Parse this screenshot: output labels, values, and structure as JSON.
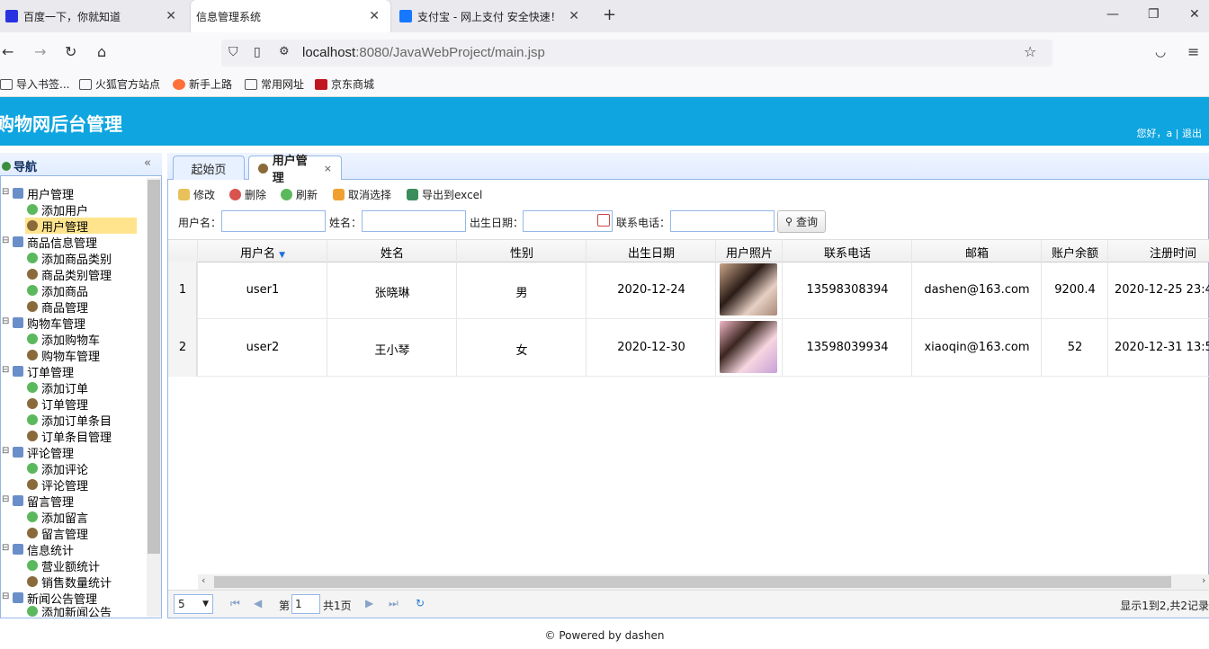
{
  "browser": {
    "tabs": [
      {
        "title": "百度一下，你就知道"
      },
      {
        "title": "信息管理系统"
      },
      {
        "title": "支付宝 - 网上支付 安全快速！"
      }
    ],
    "url_host": "localhost",
    "url_rest": ":8080/JavaWebProject/main.jsp",
    "bookmarks": [
      "导入书签...",
      "火狐官方站点",
      "新手上路",
      "常用网址",
      "京东商城"
    ]
  },
  "app": {
    "title": "购物网后台管理",
    "greeting": "您好，a | 退出",
    "footer": "© Powered by dashen"
  },
  "sidebar": {
    "title": "导航",
    "collapse": "«",
    "groups": [
      {
        "label": "用户管理",
        "items": [
          "添加用户",
          "用户管理"
        ]
      },
      {
        "label": "商品信息管理",
        "items": [
          "添加商品类别",
          "商品类别管理",
          "添加商品",
          "商品管理"
        ]
      },
      {
        "label": "购物车管理",
        "items": [
          "添加购物车",
          "购物车管理"
        ]
      },
      {
        "label": "订单管理",
        "items": [
          "添加订单",
          "订单管理",
          "添加订单条目",
          "订单条目管理"
        ]
      },
      {
        "label": "评论管理",
        "items": [
          "添加评论",
          "评论管理"
        ]
      },
      {
        "label": "留言管理",
        "items": [
          "添加留言",
          "留言管理"
        ]
      },
      {
        "label": "信息统计",
        "items": [
          "营业额统计",
          "销售数量统计"
        ]
      },
      {
        "label": "新闻公告管理",
        "items": [
          "添加新闻公告"
        ]
      }
    ]
  },
  "panel": {
    "tabs": [
      {
        "label": "起始页"
      },
      {
        "label": "用户管理",
        "close": "×"
      }
    ],
    "toolbar": {
      "edit": "修改",
      "delete": "删除",
      "refresh": "刷新",
      "cancel_select": "取消选择",
      "export": "导出到excel"
    },
    "search": {
      "username_label": "用户名：",
      "name_label": "姓名：",
      "birth_label": "出生日期：",
      "phone_label": "联系电话：",
      "query_button": "查询"
    },
    "grid": {
      "columns": [
        "用户名",
        "姓名",
        "性别",
        "出生日期",
        "用户照片",
        "联系电话",
        "邮箱",
        "账户余额",
        "注册时间"
      ],
      "rows": [
        {
          "num": "1",
          "username": "user1",
          "name": "张晓琳",
          "gender": "男",
          "birth": "2020-12-24",
          "phone": "13598308394",
          "email": "dashen@163.com",
          "balance": "9200.4",
          "regtime": "2020-12-25 23:4"
        },
        {
          "num": "2",
          "username": "user2",
          "name": "王小琴",
          "gender": "女",
          "birth": "2020-12-30",
          "phone": "13598039934",
          "email": "xiaoqin@163.com",
          "balance": "52",
          "regtime": "2020-12-31 13:5"
        }
      ]
    },
    "pager": {
      "page_size": "5",
      "page_label": "第",
      "page_value": "1",
      "total_pages": "共1页",
      "info": "显示1到2,共2记录"
    }
  },
  "colors": {
    "header": "#0ea5e0",
    "border": "#95b8e7",
    "selected": "#ffe48d"
  }
}
